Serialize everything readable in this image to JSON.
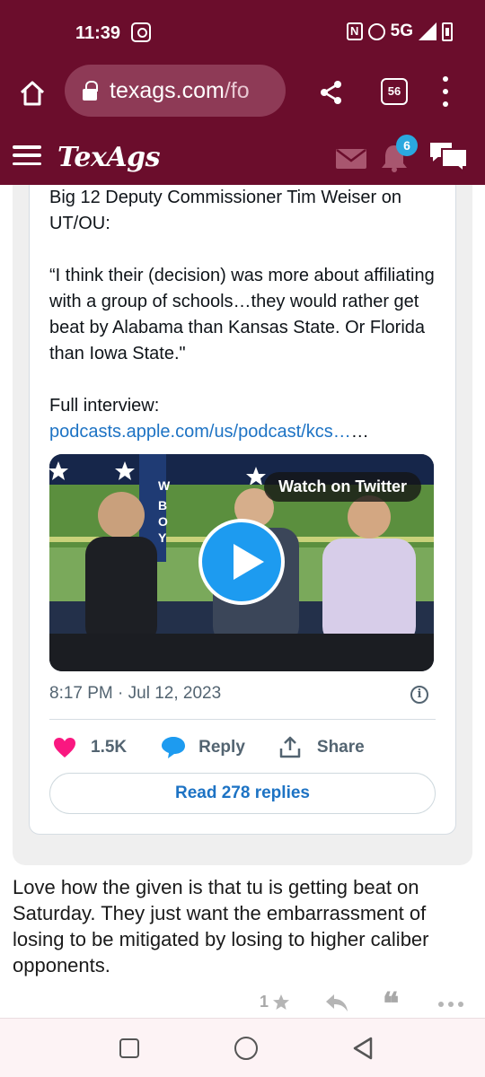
{
  "status": {
    "time": "11:39",
    "network": "5G"
  },
  "browser": {
    "url_main": "texags.com",
    "url_rest": "/fo",
    "tab_count": "56"
  },
  "site": {
    "logo": "TexAgs",
    "notification_count": "6"
  },
  "tweet": {
    "line1": "Big 12 Deputy Commissioner Tim Weiser on UT/OU:",
    "quote": "“I think their (decision) was more about affiliating with a group of schools…they would rather get beat by Alabama than Kansas State. Or Florida than Iowa State.\"",
    "interview_label": "Full interview:",
    "link": "podcasts.apple.com/us/podcast/kcs…",
    "link_suffix": "…",
    "watch_label": "Watch on Twitter",
    "date": "8:17 PM · Jul 12, 2023",
    "likes": "1.5K",
    "reply_label": "Reply",
    "share_label": "Share",
    "read_replies": "Read 278 replies"
  },
  "post": {
    "text": "Love how the given is that tu is getting beat on Saturday. They just want the embarrassment of losing to be mitigated by losing to higher caliber opponents.",
    "rating": "1"
  },
  "colors": {
    "header": "#6b0d2c",
    "twitter_blue": "#1d9bf0",
    "link_blue": "#1d73c4",
    "heart": "#f91880"
  }
}
